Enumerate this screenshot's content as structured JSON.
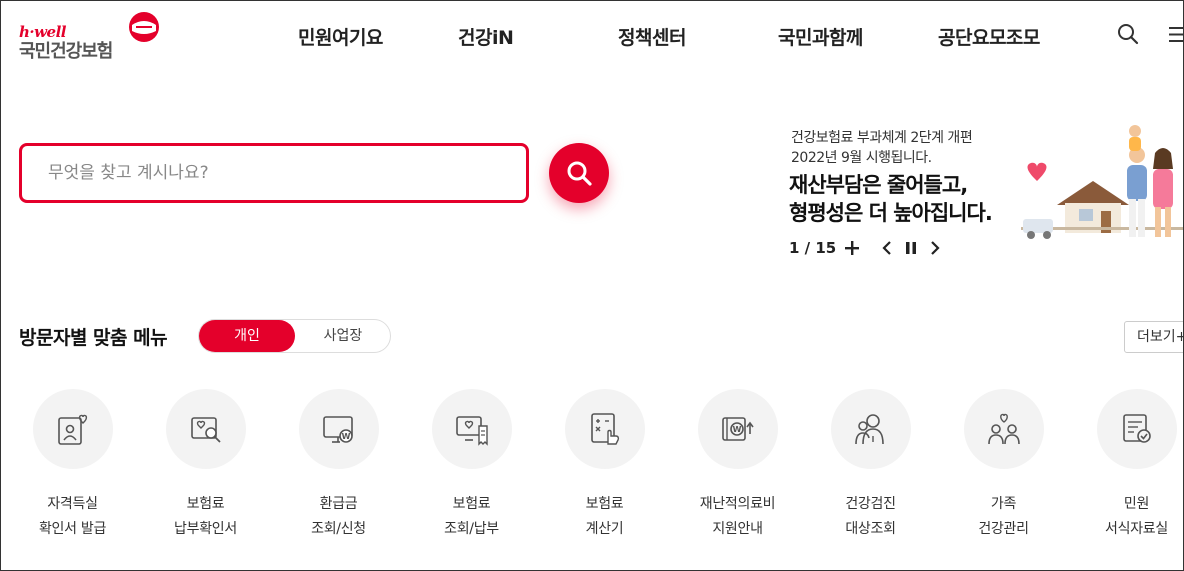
{
  "header": {
    "logo_hwell": "h·well",
    "logo_text": "국민건강보험",
    "nav": [
      "민원여기요",
      "건강iN",
      "정책센터",
      "국민과함께",
      "공단요모조모"
    ]
  },
  "search": {
    "placeholder": "무엇을 찾고 계시나요?",
    "value": ""
  },
  "banner": {
    "subtitle_line1": "건강보험료 부과체계 2단계 개편",
    "subtitle_line2": "2022년 9월 시행됩니다.",
    "title_line1": "재산부담은 줄어들고,",
    "title_line2": "형평성은 더 높아집니다.",
    "counter": "1 / 15"
  },
  "visitor_menu": {
    "title": "방문자별 맞춤 메뉴",
    "tabs": [
      "개인",
      "사업장"
    ],
    "active_tab": "개인",
    "more": "더보기+",
    "items": [
      {
        "line1": "자격득실",
        "line2": "확인서 발급",
        "icon": "id-card-heart-icon"
      },
      {
        "line1": "보험료",
        "line2": "납부확인서",
        "icon": "document-search-icon"
      },
      {
        "line1": "환급금",
        "line2": "조회/신청",
        "icon": "monitor-won-icon"
      },
      {
        "line1": "보험료",
        "line2": "조회/납부",
        "icon": "monitor-receipt-icon"
      },
      {
        "line1": "보험료",
        "line2": "계산기",
        "icon": "calculator-hand-icon"
      },
      {
        "line1": "재난적의료비",
        "line2": "지원안내",
        "icon": "won-card-arrow-icon"
      },
      {
        "line1": "건강검진",
        "line2": "대상조회",
        "icon": "people-checkup-icon"
      },
      {
        "line1": "가족",
        "line2": "건강관리",
        "icon": "family-heart-icon"
      },
      {
        "line1": "민원",
        "line2": "서식자료실",
        "icon": "form-check-icon"
      }
    ]
  },
  "colors": {
    "brand_red": "#e4002b",
    "icon_gray": "#555555",
    "circle_bg": "#f3f3f3"
  }
}
